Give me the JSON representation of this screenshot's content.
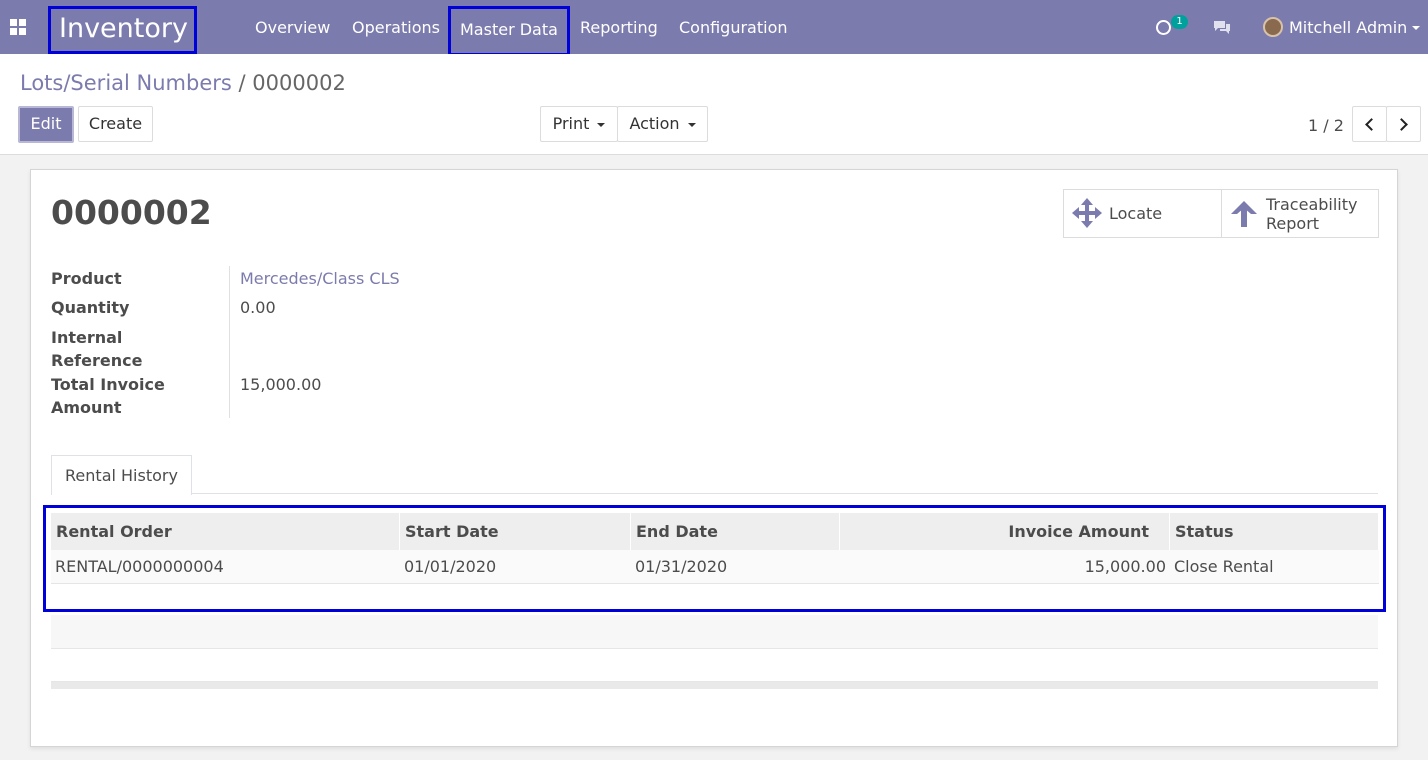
{
  "nav": {
    "app_name": "Inventory",
    "menu": [
      "Overview",
      "Operations",
      "Master Data",
      "Reporting",
      "Configuration"
    ],
    "activity_count": "1",
    "user_name": "Mitchell Admin"
  },
  "breadcrumb": {
    "parent": "Lots/Serial Numbers",
    "separator": "/",
    "current": "0000002"
  },
  "toolbar": {
    "edit_label": "Edit",
    "create_label": "Create",
    "print_label": "Print",
    "action_label": "Action"
  },
  "pager": {
    "value": "1 / 2"
  },
  "record": {
    "title": "0000002",
    "smart_buttons": {
      "locate": "Locate",
      "traceability_line1": "Traceability",
      "traceability_line2": "Report"
    },
    "fields": {
      "product_label": "Product",
      "product_value": "Mercedes/Class CLS",
      "quantity_label": "Quantity",
      "quantity_value": "0.00",
      "internal_ref_label_1": "Internal",
      "internal_ref_label_2": "Reference",
      "total_invoice_label_1": "Total Invoice",
      "total_invoice_label_2": "Amount",
      "total_invoice_value": "15,000.00"
    }
  },
  "tabs": {
    "rental_history": "Rental History"
  },
  "rental_table": {
    "columns": [
      "Rental Order",
      "Start Date",
      "End Date",
      "Invoice Amount",
      "Status"
    ],
    "rows": [
      [
        "RENTAL/0000000004",
        "01/01/2020",
        "01/31/2020",
        "15,000.00",
        "Close Rental"
      ]
    ]
  },
  "colors": {
    "brand": "#7c7bad",
    "highlight": "#0000d8",
    "badge": "#00a09d"
  }
}
